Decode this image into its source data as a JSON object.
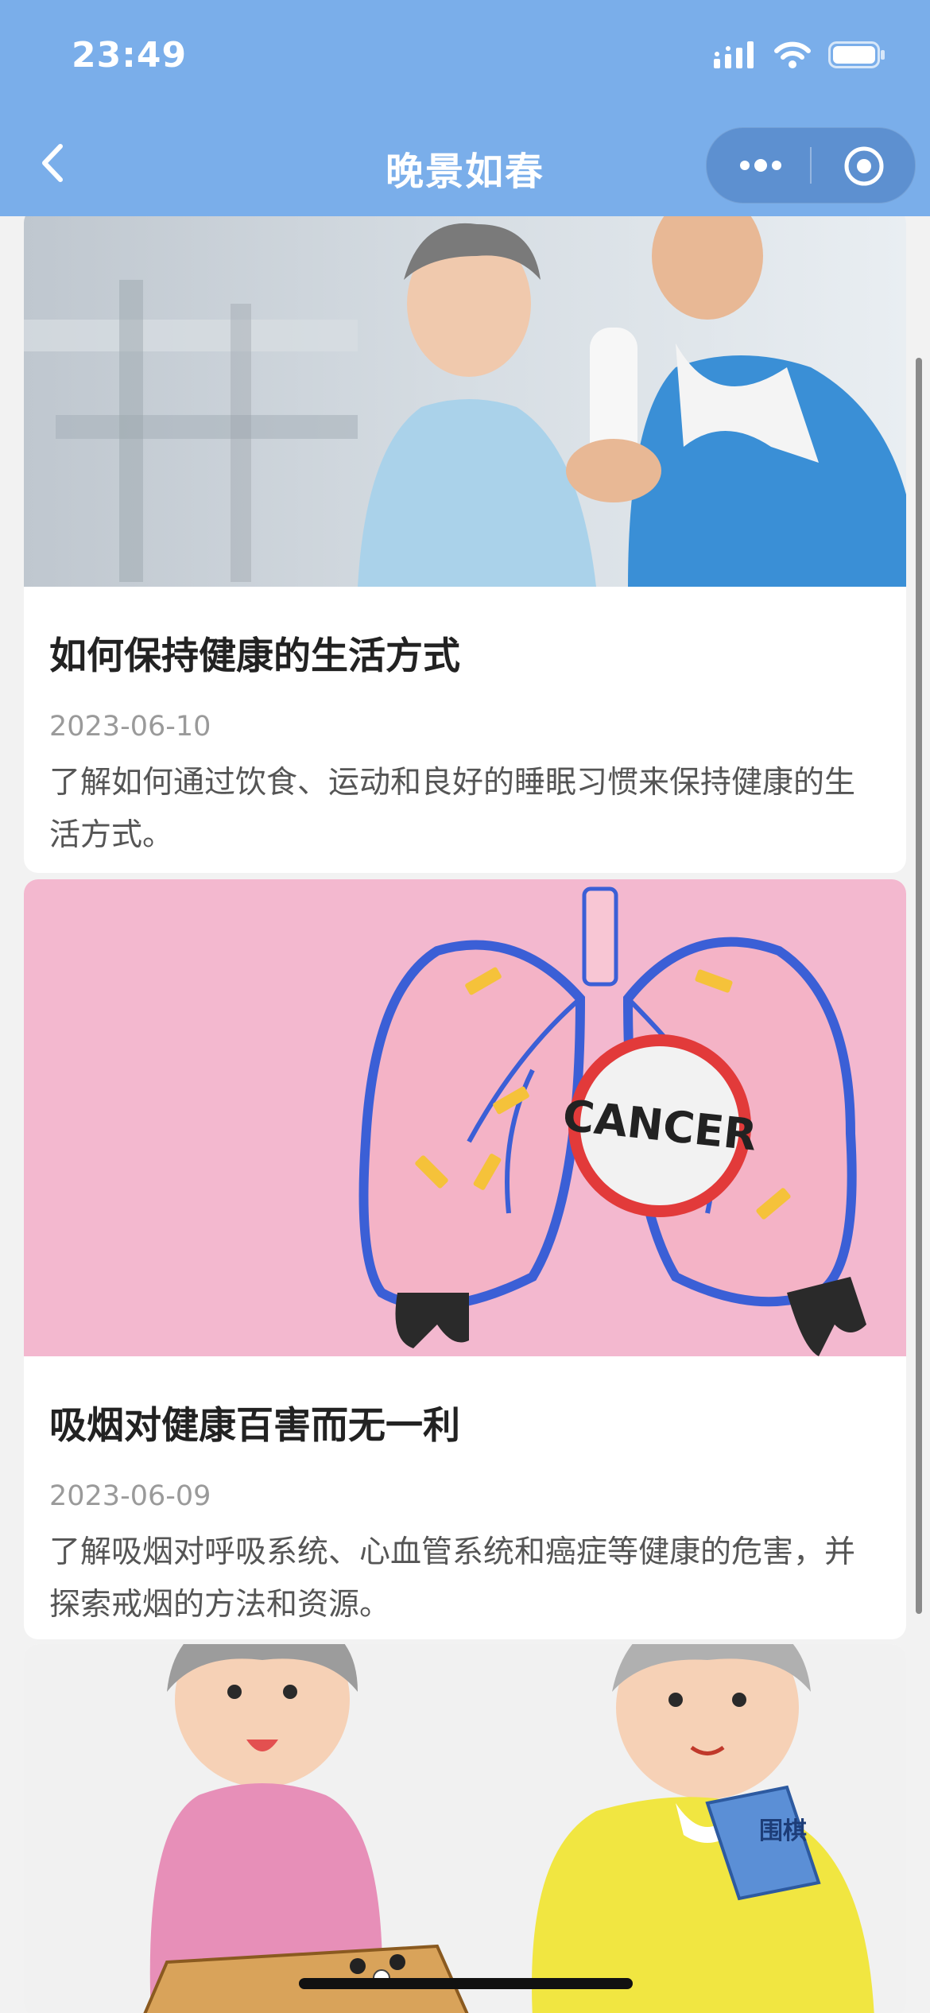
{
  "status_bar": {
    "time": "23:49"
  },
  "nav": {
    "title": "晚景如春",
    "icons": {
      "back": "chevron-left-icon",
      "more": "more-dots-icon",
      "close": "target-close-icon"
    }
  },
  "articles": [
    {
      "title": "如何保持健康的生活方式",
      "date": "2023-06-10",
      "summary": "了解如何通过饮食、运动和良好的睡眠习惯来保持健康的生活方式。",
      "image_label": "elderly-couple-fitness-photo"
    },
    {
      "title": "吸烟对健康百害而无一利",
      "date": "2023-06-09",
      "summary": "了解吸烟对呼吸系统、心血管系统和癌症等健康的危害，并探索戒烟的方法和资源。",
      "image_label": "lungs-cancer-illustration",
      "image_text": "CANCER"
    },
    {
      "image_label": "elderly-playing-go-illustration",
      "image_text": "围棋"
    }
  ],
  "colors": {
    "header_bg": "#7aaeea",
    "card_bg": "#ffffff",
    "page_bg": "#f2f2f2",
    "title_text": "#222222",
    "date_text": "#9a9a9a",
    "desc_text": "#555555"
  }
}
